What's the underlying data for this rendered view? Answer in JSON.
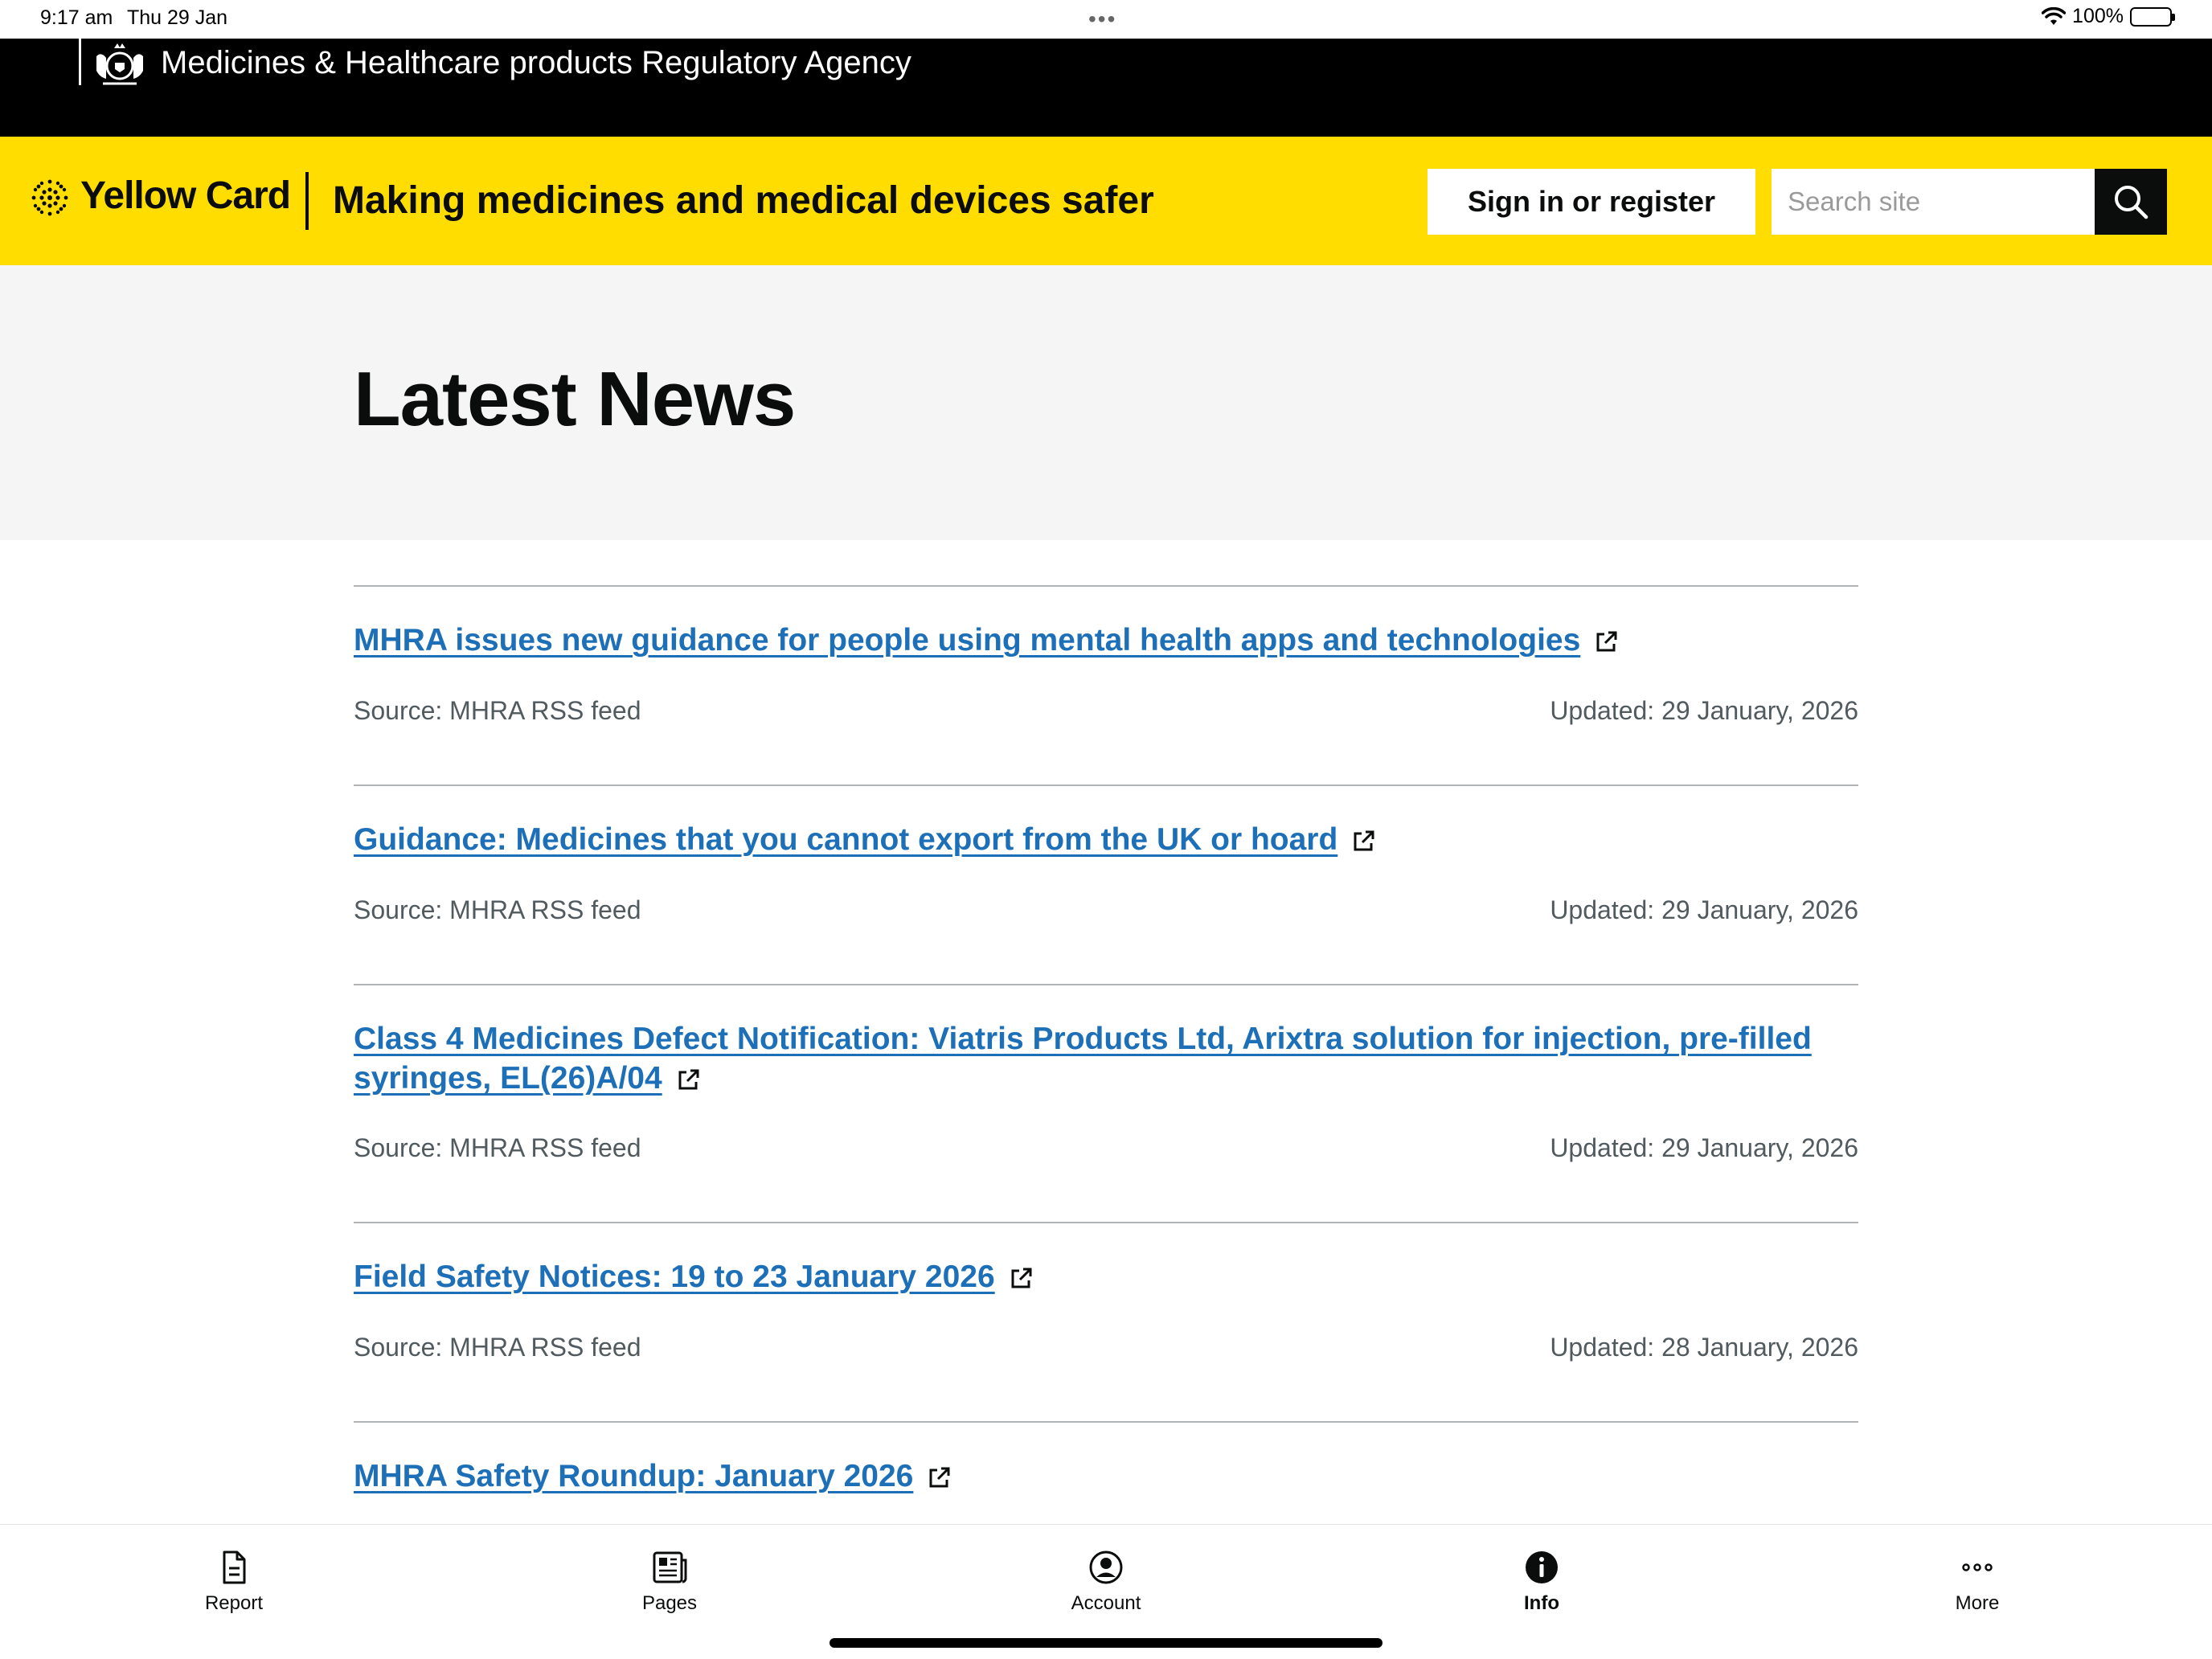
{
  "status_bar": {
    "time": "9:17 am",
    "date": "Thu 29 Jan",
    "battery": "100%"
  },
  "agency": {
    "name": "Medicines & Healthcare products Regulatory Agency"
  },
  "header": {
    "logo_text": "Yellow Card",
    "tagline": "Making medicines and medical devices safer",
    "signin_label": "Sign in or register",
    "search_placeholder": "Search site"
  },
  "hero": {
    "title": "Latest News"
  },
  "news": [
    {
      "title": "MHRA issues new guidance for people using mental health apps and technologies",
      "source": "Source: MHRA RSS feed",
      "updated": "Updated: 29 January, 2026"
    },
    {
      "title": "Guidance: Medicines that you cannot export from the UK or hoard",
      "source": "Source: MHRA RSS feed",
      "updated": "Updated: 29 January, 2026"
    },
    {
      "title": "Class 4 Medicines Defect Notification: Viatris Products Ltd, Arixtra solution for injection, pre-filled syringes, EL(26)A/04",
      "source": "Source: MHRA RSS feed",
      "updated": "Updated: 29 January, 2026"
    },
    {
      "title": "Field Safety Notices: 19 to 23 January 2026",
      "source": "Source: MHRA RSS feed",
      "updated": "Updated: 28 January, 2026"
    },
    {
      "title": "MHRA Safety Roundup: January 2026"
    }
  ],
  "tabs": [
    {
      "label": "Report",
      "icon": "document-icon"
    },
    {
      "label": "Pages",
      "icon": "newspaper-icon"
    },
    {
      "label": "Account",
      "icon": "account-icon"
    },
    {
      "label": "Info",
      "icon": "info-icon",
      "active": true
    },
    {
      "label": "More",
      "icon": "more-icon"
    }
  ],
  "colors": {
    "brand_yellow": "#ffdd00",
    "link_blue": "#1d70b8",
    "agency_black": "#000000"
  }
}
